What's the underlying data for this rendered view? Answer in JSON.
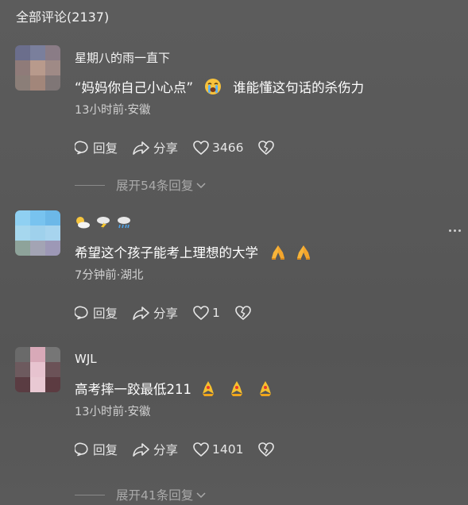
{
  "header": {
    "title": "全部评论",
    "count": "(2137)"
  },
  "comments": [
    {
      "username": "星期八的雨一直下",
      "text": "“妈妈你自己小心点”",
      "emoji": "crying-face",
      "text_after": "谁能懂这句话的杀伤力",
      "meta": "13小时前·安徽",
      "reply_label": "回复",
      "share_label": "分享",
      "likes": "3466",
      "expand_label": "展开54条回复"
    },
    {
      "username_icons": [
        "sun-behind-cloud",
        "lightning-cloud",
        "rain-cloud"
      ],
      "text": "希望这个孩子能考上理想的大学",
      "emoji": "folded-hands",
      "meta": "7分钟前·湖北",
      "reply_label": "回复",
      "share_label": "分享",
      "likes": "1"
    },
    {
      "username": "WJL",
      "text": "高考摔一跤最低211",
      "emoji": "chick-hands",
      "meta": "13小时前·安徽",
      "reply_label": "回复",
      "share_label": "分享",
      "likes": "1401",
      "expand_label": "展开41条回复"
    }
  ]
}
